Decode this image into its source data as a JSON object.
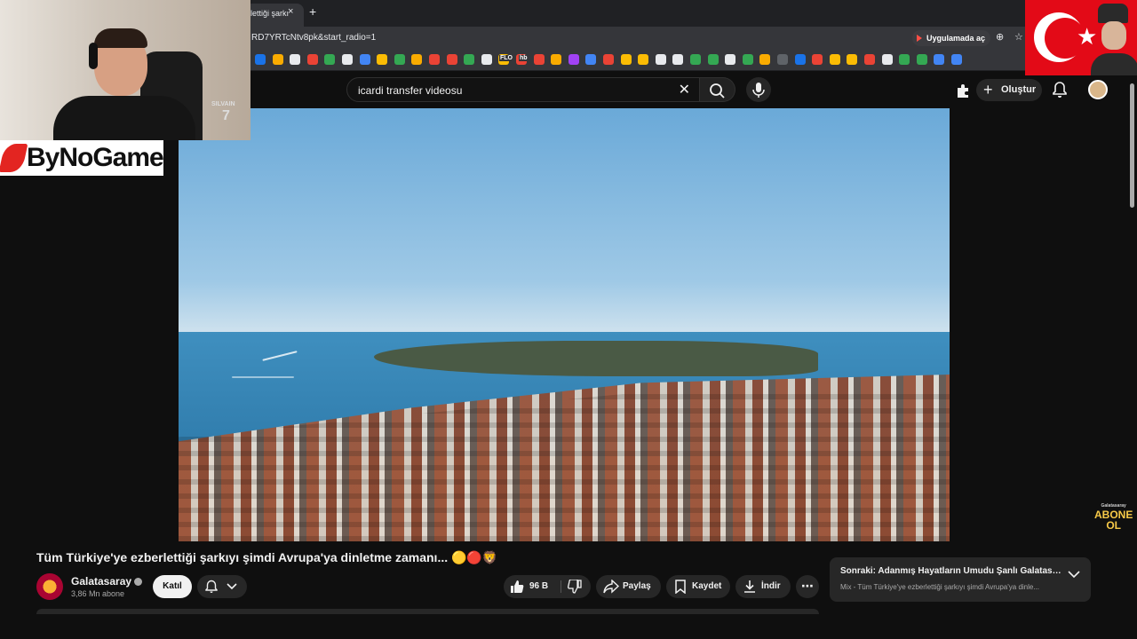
{
  "browser": {
    "tab_title": "lettiği şarkı",
    "url": "RD7YRTcNtv8pk&start_radio=1",
    "open_in_app_label": "Uygulamada aç",
    "bookmark_colors": [
      "#1a73e8",
      "#f9ab00",
      "#e8eaed",
      "#ea4335",
      "#34a853",
      "#e8eaed",
      "#4285f4",
      "#fbbc04",
      "#34a853",
      "#f9ab00",
      "#ea4335",
      "#ea4335",
      "#34a853",
      "#e8eaed",
      "#fbbc04",
      "#ea4335",
      "#ea4335",
      "#f9ab00",
      "#a142f4",
      "#4285f4",
      "#ea4335",
      "#fbbc04",
      "#fbbc04",
      "#e8eaed",
      "#e8eaed",
      "#34a853",
      "#34a853",
      "#e8eaed",
      "#34a853",
      "#f9ab00",
      "#5f6368",
      "#1a73e8",
      "#ea4335",
      "#fbbc04",
      "#fbbc04",
      "#ea4335",
      "#e8eaed",
      "#34a853",
      "#34a853",
      "#4285f4",
      "#4285f4"
    ],
    "bookmark_labels": [
      "FLO",
      "hb"
    ]
  },
  "youtube": {
    "search_query": "icardi transfer videosu",
    "create_label": "Oluştur"
  },
  "overlay": {
    "brand_text": "ByNoGame",
    "jersey_name": "SILVAIN",
    "jersey_number": "7",
    "abone_top": "Galatasaray",
    "abone_main": "ABONE",
    "abone_bottom": "OL"
  },
  "video": {
    "title": "Tüm Türkiye'ye ezberlettiği şarkıyı şimdi Avrupa'ya dinletme zamanı... 🟡🔴🦁",
    "channel_name": "Galatasaray",
    "subscribers": "3,86 Mn abone",
    "join_label": "Katıl",
    "like_count": "96 B",
    "share_label": "Paylaş",
    "save_label": "Kaydet",
    "download_label": "İndir"
  },
  "up_next": {
    "title": "Sonraki: Adanmış Hayatların Umudu Şanlı Galatasa...",
    "subtitle": "Mix - Tüm Türkiye'ye ezberlettiği şarkıyı şimdi Avrupa'ya dinle..."
  }
}
